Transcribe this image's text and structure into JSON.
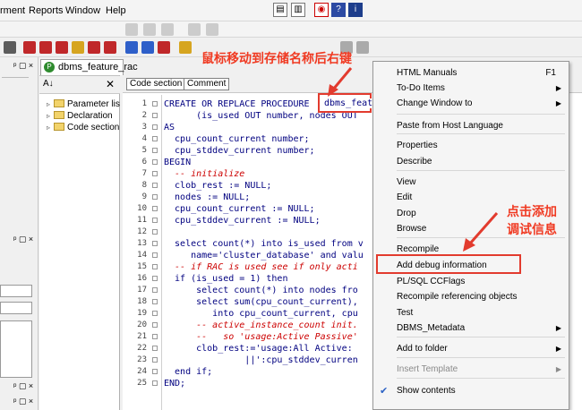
{
  "menubar": {
    "items": [
      "rment",
      "Reports",
      "Window",
      "Help"
    ]
  },
  "tab": {
    "label": "dbms_feature_rac"
  },
  "nav": {
    "items": [
      "Parameter lis",
      "Declaration",
      "Code section"
    ]
  },
  "editor": {
    "tabs": [
      "Code section",
      "Comment"
    ],
    "line_numbers": [
      "1",
      "2",
      "3",
      "4",
      "5",
      "6",
      "7",
      "8",
      "9",
      "10",
      "11",
      "12",
      "13",
      "14",
      "15",
      "16",
      "17",
      "18",
      "19",
      "20",
      "21",
      "22",
      "23",
      "24",
      "25"
    ],
    "lines": [
      "CREATE OR REPLACE PROCEDURE",
      "      (is_used OUT number, nodes OUT",
      "AS",
      "  cpu_count_current number;",
      "  cpu_stddev_current number;",
      "BEGIN",
      "  -- initialize",
      "  clob_rest := NULL;",
      "  nodes := NULL;",
      "  cpu_count_current := NULL;",
      "  cpu_stddev_current := NULL;",
      "",
      "  select count(*) into is_used from v",
      "     name='cluster_database' and valu",
      "  -- if RAC is used see if only acti",
      "  if (is_used = 1) then",
      "      select count(*) into nodes fro",
      "      select sum(cpu_count_current),",
      "         into cpu_count_current, cpu",
      "      -- active_instance_count init.",
      "      --   so 'usage:Active Passive'",
      "      clob_rest:='usage:All Active:",
      "               ||':cpu_stddev_curren",
      "  end if;",
      "END;"
    ],
    "highlighted_name": "dbms_feat"
  },
  "annotations": {
    "top": "鼠标移动到存储名称后右键",
    "right_line1": "点击添加",
    "right_line2": "调试信息"
  },
  "context_menu": {
    "items": [
      {
        "label": "HTML Manuals",
        "shortcut": "F1"
      },
      {
        "label": "To-Do Items",
        "submenu": true
      },
      {
        "label": "Change Window to",
        "submenu": true
      },
      {
        "label": "Paste from Host Language"
      },
      {
        "label": "Properties"
      },
      {
        "label": "Describe"
      },
      {
        "label": "View"
      },
      {
        "label": "Edit"
      },
      {
        "label": "Drop"
      },
      {
        "label": "Browse"
      },
      {
        "label": "Recompile"
      },
      {
        "label": "Add debug information"
      },
      {
        "label": "PL/SQL CCFlags"
      },
      {
        "label": "Recompile referencing objects"
      },
      {
        "label": "Test"
      },
      {
        "label": "DBMS_Metadata",
        "submenu": true
      },
      {
        "label": "Add to folder",
        "submenu": true
      },
      {
        "label": "Insert Template",
        "submenu": true,
        "disabled": true
      },
      {
        "label": "Show contents",
        "checked": true
      }
    ]
  },
  "colors": {
    "annotation": "#f03a22",
    "keyword": "#000080",
    "comment": "#cc0000"
  }
}
